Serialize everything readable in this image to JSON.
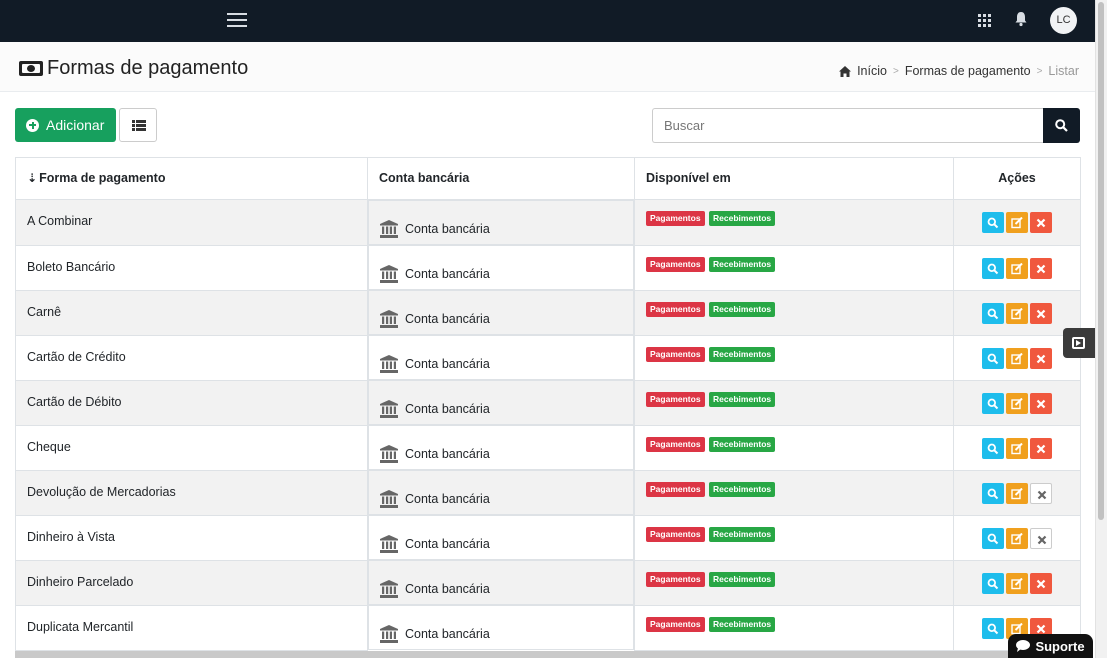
{
  "topbar": {
    "avatar_initials": "LC",
    "menu_icon": "hamburger-icon",
    "apps_icon": "grid-icon",
    "notifications_icon": "bell-icon"
  },
  "header": {
    "title": "Formas de pagamento",
    "title_icon": "money-bill-icon",
    "breadcrumb": {
      "home": "Início",
      "section": "Formas de pagamento",
      "current": "Listar"
    }
  },
  "toolbar": {
    "add_label": "Adicionar",
    "search_placeholder": "Buscar"
  },
  "table": {
    "columns": [
      "Forma de pagamento",
      "Conta bancária",
      "Disponível em",
      "Ações"
    ],
    "sort_indicator": "⇣",
    "badge_pagamentos": "Pagamentos",
    "badge_recebimentos": "Recebimentos",
    "rows": [
      {
        "name": "A Combinar",
        "account": "Conta bancária",
        "delete_enabled": true
      },
      {
        "name": "Boleto Bancário",
        "account": "Conta bancária",
        "delete_enabled": true
      },
      {
        "name": "Carnê",
        "account": "Conta bancária",
        "delete_enabled": true
      },
      {
        "name": "Cartão de Crédito",
        "account": "Conta bancária",
        "delete_enabled": true
      },
      {
        "name": "Cartão de Débito",
        "account": "Conta bancária",
        "delete_enabled": true
      },
      {
        "name": "Cheque",
        "account": "Conta bancária",
        "delete_enabled": true
      },
      {
        "name": "Devolução de Mercadorias",
        "account": "Conta bancária",
        "delete_enabled": false
      },
      {
        "name": "Dinheiro à Vista",
        "account": "Conta bancária",
        "delete_enabled": false
      },
      {
        "name": "Dinheiro Parcelado",
        "account": "Conta bancária",
        "delete_enabled": true
      },
      {
        "name": "Duplicata Mercantil",
        "account": "Conta bancária",
        "delete_enabled": true
      }
    ]
  },
  "support": {
    "label": "Suporte"
  },
  "colors": {
    "topbar": "#111b26",
    "add_button": "#17a05e",
    "badge_red": "#dc3545",
    "badge_green": "#28a745",
    "view": "#1ebdec",
    "edit": "#f0a01e",
    "delete": "#f0583e"
  }
}
